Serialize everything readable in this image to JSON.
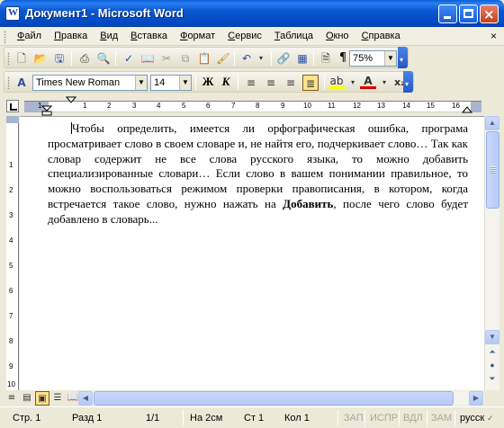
{
  "window": {
    "title": "Документ1 - Microsoft Word"
  },
  "menu": {
    "items": [
      "Файл",
      "Правка",
      "Вид",
      "Вставка",
      "Формат",
      "Сервис",
      "Таблица",
      "Окно",
      "Справка"
    ],
    "close_doc": "×"
  },
  "standard_toolbar": {
    "zoom": "75%",
    "show_marks_glyph": "¶"
  },
  "formatting_toolbar": {
    "font_name": "Times New Roman",
    "font_size": "14",
    "bold_label": "Ж",
    "italic_label": "К",
    "font_color_label": "A",
    "subscript_label": "x₂"
  },
  "ruler": {
    "numbers": [
      "1",
      "1",
      "2",
      "3",
      "4",
      "5",
      "6",
      "7",
      "8",
      "9",
      "10",
      "11",
      "12",
      "13",
      "14",
      "15",
      "16"
    ],
    "vertical_numbers": [
      "1",
      "2",
      "3",
      "4",
      "5",
      "6",
      "7",
      "8",
      "9",
      "10"
    ]
  },
  "document": {
    "paragraph_before_bold": "Чтобы определить, имеется ли орфографическая ошибка, програма просматривает слово в своем словаре и, не найтя его, подчеркивает слово… Так как словар содержит не все слова русского языка, то можно добавить специализированные словари… Если слово в вашем понимании правильное, то можно воспользоваться режимом проверки правописания, в котором, когда встречается такое слово, нужно нажать на ",
    "bold_word": "Добавить",
    "paragraph_after_bold": ", после чего слово будет добавлено в словарь..."
  },
  "status_bar": {
    "page": "Стр. 1",
    "section": "Разд 1",
    "page_of": "1/1",
    "position": "На 2см",
    "line": "Ст 1",
    "column": "Кол 1",
    "rec": "ЗАП",
    "trk": "ИСПР",
    "ext": "ВДЛ",
    "ovr": "ЗАМ",
    "language": "русск"
  }
}
